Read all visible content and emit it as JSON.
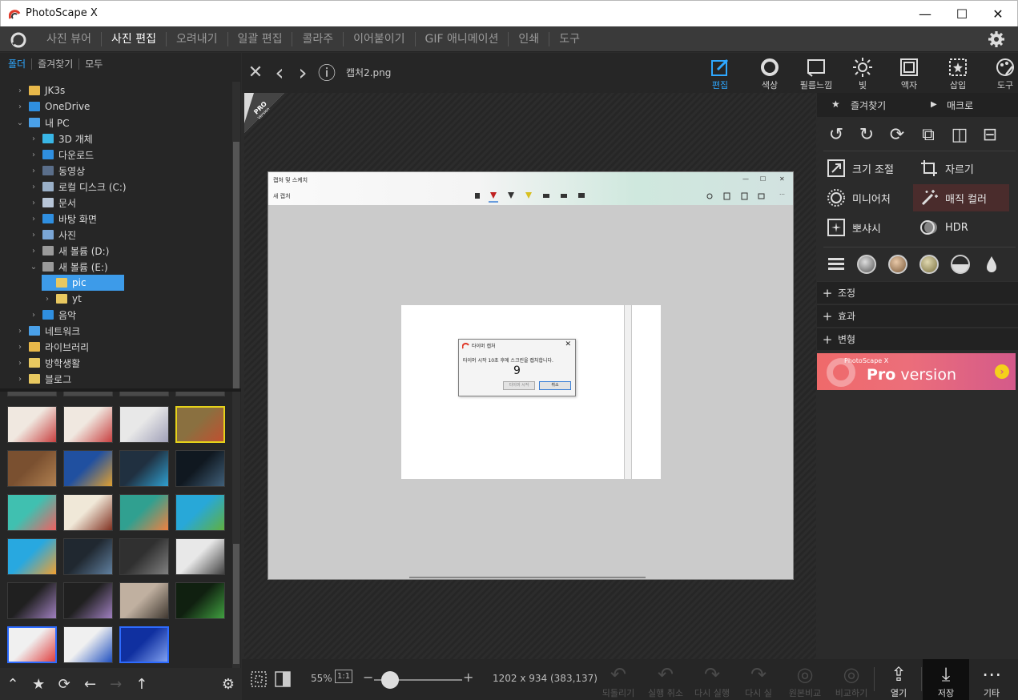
{
  "window": {
    "title": "PhotoScape X",
    "minimize": "—",
    "maximize": "☐",
    "close": "✕"
  },
  "menu": {
    "items": [
      "사진 뷰어",
      "사진 편집",
      "오려내기",
      "일괄 편집",
      "콜라주",
      "이어붙이기",
      "GIF 애니메이션",
      "인쇄",
      "도구"
    ],
    "active_index": 1
  },
  "folder_tabs": [
    "폴더",
    "즐겨찾기",
    "모두"
  ],
  "tree": [
    {
      "label": "JK3s",
      "depth": 0,
      "chev": "›",
      "color": "#e8b84a"
    },
    {
      "label": "OneDrive",
      "depth": 0,
      "chev": "›",
      "color": "#2f8fe0"
    },
    {
      "label": "내 PC",
      "depth": 0,
      "chev": "⌄",
      "color": "#4aa0e8"
    },
    {
      "label": "3D 개체",
      "depth": 1,
      "chev": "›",
      "color": "#39b6e6"
    },
    {
      "label": "다운로드",
      "depth": 1,
      "chev": "›",
      "color": "#2f8fe0"
    },
    {
      "label": "동영상",
      "depth": 1,
      "chev": "›",
      "color": "#5a6e8a"
    },
    {
      "label": "로컬 디스크 (C:)",
      "depth": 1,
      "chev": "›",
      "color": "#9ab0c8"
    },
    {
      "label": "문서",
      "depth": 1,
      "chev": "›",
      "color": "#b8c6d8"
    },
    {
      "label": "바탕 화면",
      "depth": 1,
      "chev": "›",
      "color": "#2f8fe0"
    },
    {
      "label": "사진",
      "depth": 1,
      "chev": "›",
      "color": "#7aa6d6"
    },
    {
      "label": "새 볼륨 (D:)",
      "depth": 1,
      "chev": "›",
      "color": "#9a9a9a"
    },
    {
      "label": "새 볼륨 (E:)",
      "depth": 1,
      "chev": "⌄",
      "color": "#9a9a9a"
    },
    {
      "label": "pic",
      "depth": 2,
      "chev": "",
      "color": "#e8c860",
      "selected": true
    },
    {
      "label": "yt",
      "depth": 2,
      "chev": "›",
      "color": "#e8c860"
    },
    {
      "label": "음악",
      "depth": 1,
      "chev": "›",
      "color": "#2f8fe0"
    },
    {
      "label": "네트워크",
      "depth": 0,
      "chev": "›",
      "color": "#4aa0e8"
    },
    {
      "label": "라이브러리",
      "depth": 0,
      "chev": "›",
      "color": "#e8b84a"
    },
    {
      "label": "방학생활",
      "depth": 0,
      "chev": "›",
      "color": "#e8c860"
    },
    {
      "label": "블로그",
      "depth": 0,
      "chev": "›",
      "color": "#e8c860"
    }
  ],
  "thumbnails": [
    {
      "c1": "#f0e8e0",
      "c2": "#c84040"
    },
    {
      "c1": "#f0e8e0",
      "c2": "#c84040"
    },
    {
      "c1": "#e8e8e8",
      "c2": "#a0a0b8"
    },
    {
      "c1": "#8a7040",
      "c2": "#c05030",
      "style": "yel"
    },
    {
      "c1": "#7a5030",
      "c2": "#b08050"
    },
    {
      "c1": "#2050a0",
      "c2": "#e0a030"
    },
    {
      "c1": "#203040",
      "c2": "#30a0d0"
    },
    {
      "c1": "#101820",
      "c2": "#40607a"
    },
    {
      "c1": "#40c0b0",
      "c2": "#f06060"
    },
    {
      "c1": "#f0e8d8",
      "c2": "#803020"
    },
    {
      "c1": "#30a090",
      "c2": "#f08040"
    },
    {
      "c1": "#28a8d8",
      "c2": "#60b040"
    },
    {
      "c1": "#28a8e0",
      "c2": "#f0a030"
    },
    {
      "c1": "#202830",
      "c2": "#6080a0"
    },
    {
      "c1": "#303030",
      "c2": "#808080"
    },
    {
      "c1": "#e8e8e8",
      "c2": "#404040"
    },
    {
      "c1": "#202020",
      "c2": "#a080c0"
    },
    {
      "c1": "#202020",
      "c2": "#a080c0"
    },
    {
      "c1": "#c0b0a0",
      "c2": "#403830"
    },
    {
      "c1": "#102010",
      "c2": "#40a040"
    },
    {
      "c1": "#f0f0f0",
      "c2": "#e04040",
      "style": "sel"
    },
    {
      "c1": "#f0f0f0",
      "c2": "#2050c0"
    },
    {
      "c1": "#1030a0",
      "c2": "#80a0f0",
      "style": "sel"
    }
  ],
  "left_bottom": {
    "up": "⌃",
    "star": "★",
    "refresh": "⟳",
    "back": "←",
    "forward": "→",
    "upload": "↑",
    "settings": "⚙"
  },
  "collapse_arrow": "‹",
  "viewer": {
    "close": "✕",
    "prev": "‹",
    "next": "›",
    "info": "ⓘ",
    "filename": "캡처2.png"
  },
  "pro_badge": {
    "line1": "PRO",
    "line2": "Version"
  },
  "screenshot": {
    "app_title": "캡처 및 스케치",
    "min": "—",
    "max": "☐",
    "close": "✕",
    "toolbar_new": "새 캡처",
    "toolbar_more": "…",
    "dialog_title": "타이머 캡처",
    "dialog_close": "✕",
    "dialog_message": "타이머 시작 10초 후에 스크린을 캡처합니다.",
    "dialog_count": "9",
    "btn_start": "타이머 시작",
    "btn_cancel": "취소"
  },
  "right_tools": [
    {
      "label": "편집",
      "icon": "edit-icon",
      "active": true
    },
    {
      "label": "색상",
      "icon": "color-icon"
    },
    {
      "label": "필름느낌",
      "icon": "film-icon"
    },
    {
      "label": "빛",
      "icon": "light-icon"
    },
    {
      "label": "액자",
      "icon": "frame-icon"
    },
    {
      "label": "삽입",
      "icon": "insert-icon"
    },
    {
      "label": "도구",
      "icon": "tools-icon"
    }
  ],
  "right_panel": {
    "favorites": "즐겨찾기",
    "macro": "매크로",
    "resize": "크기 조절",
    "crop": "자르기",
    "miniature": "미니어처",
    "magic_color": "매직 컬러",
    "bloom": "뽀샤시",
    "hdr": "HDR",
    "sections": [
      "조정",
      "효과",
      "변형"
    ],
    "banner_small": "PhotoScape X",
    "banner_pro": "Pro",
    "banner_version": " version",
    "banner_go": "›"
  },
  "bottom": {
    "zoom": "55%",
    "one_to_one": "1:1",
    "minus": "−",
    "plus": "+",
    "zoom_level": 0.18,
    "info": "1202 x 934 (383,137)",
    "commands": [
      "되돌리기",
      "실행 취소",
      "다시 실행",
      "다시 실",
      "원본비교",
      "비교하기",
      "열기",
      "저장",
      "기타"
    ]
  }
}
